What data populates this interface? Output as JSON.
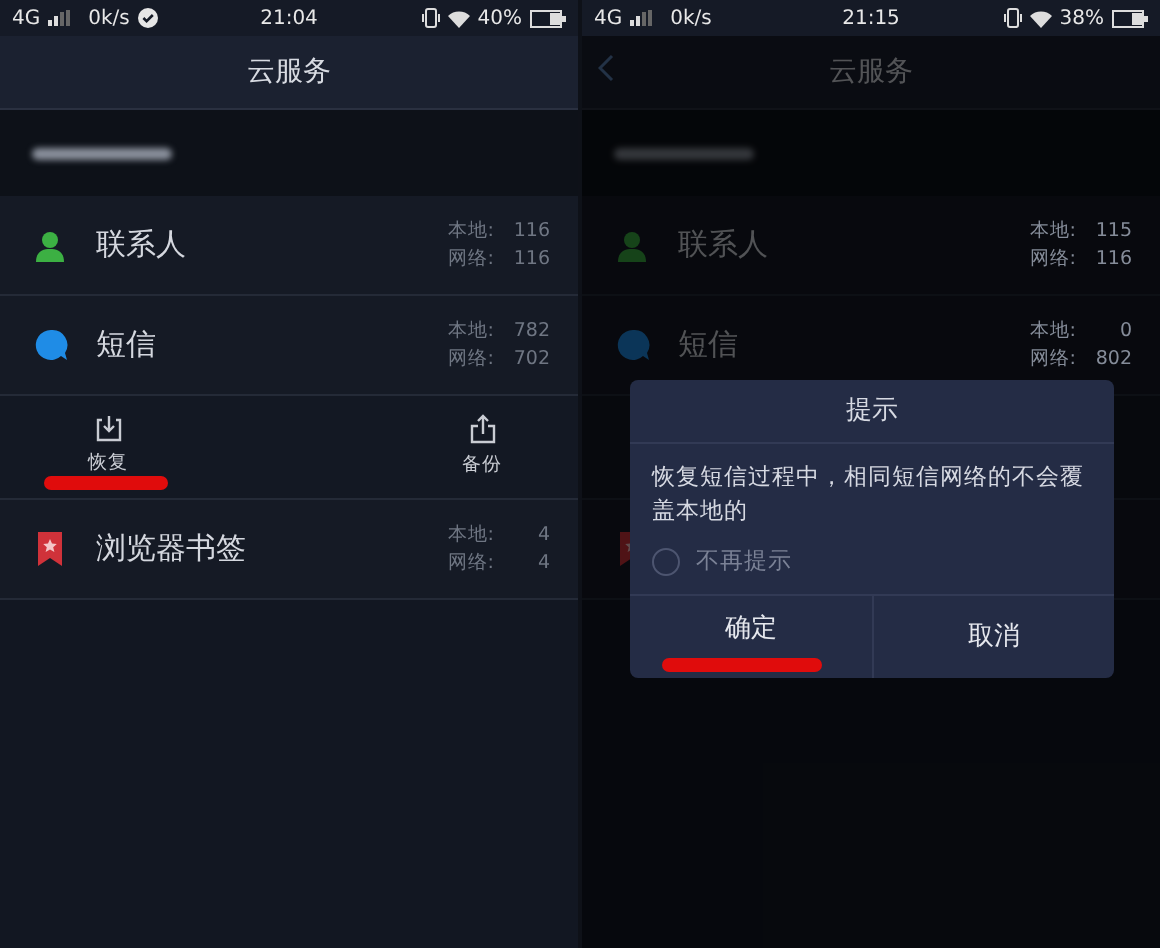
{
  "screens": [
    {
      "status_bar": {
        "network": "4G",
        "speed": "0k/s",
        "sync_ok": true,
        "time": "21:04",
        "battery": "40%"
      },
      "title": "云服务",
      "back_button": false,
      "items": [
        {
          "kind": "sync",
          "name": "联系人",
          "local_label": "本地:",
          "local": "116",
          "net_label": "网络:",
          "net": "116"
        },
        {
          "kind": "sync",
          "name": "短信",
          "local_label": "本地:",
          "local": "782",
          "net_label": "网络:",
          "net": "702"
        },
        {
          "kind": "actions",
          "actions": [
            {
              "label": "恢复",
              "annotated": true
            },
            {
              "label": "备份",
              "annotated": false
            }
          ]
        },
        {
          "kind": "sync",
          "name": "浏览器书签",
          "local_label": "本地:",
          "local": "4",
          "net_label": "网络:",
          "net": "4"
        }
      ]
    },
    {
      "status_bar": {
        "network": "4G",
        "speed": "0k/s",
        "sync_ok": false,
        "time": "21:15",
        "battery": "38%"
      },
      "title": "云服务",
      "back_button": true,
      "items": [
        {
          "kind": "sync",
          "name": "联系人",
          "local_label": "本地:",
          "local": "115",
          "net_label": "网络:",
          "net": "116"
        },
        {
          "kind": "sync",
          "name": "短信",
          "local_label": "本地:",
          "local": "0",
          "net_label": "网络:",
          "net": "802"
        },
        {
          "kind": "hidden"
        },
        {
          "kind": "sync"
        }
      ],
      "dialog": {
        "title": "提示",
        "message": "恢复短信过程中，相同短信网络的不会覆盖本地的",
        "option": {
          "label": "不再提示",
          "checked": false
        },
        "buttons": [
          {
            "label": "确定",
            "annotated": true
          },
          {
            "label": "取消",
            "annotated": false
          }
        ]
      }
    }
  ]
}
